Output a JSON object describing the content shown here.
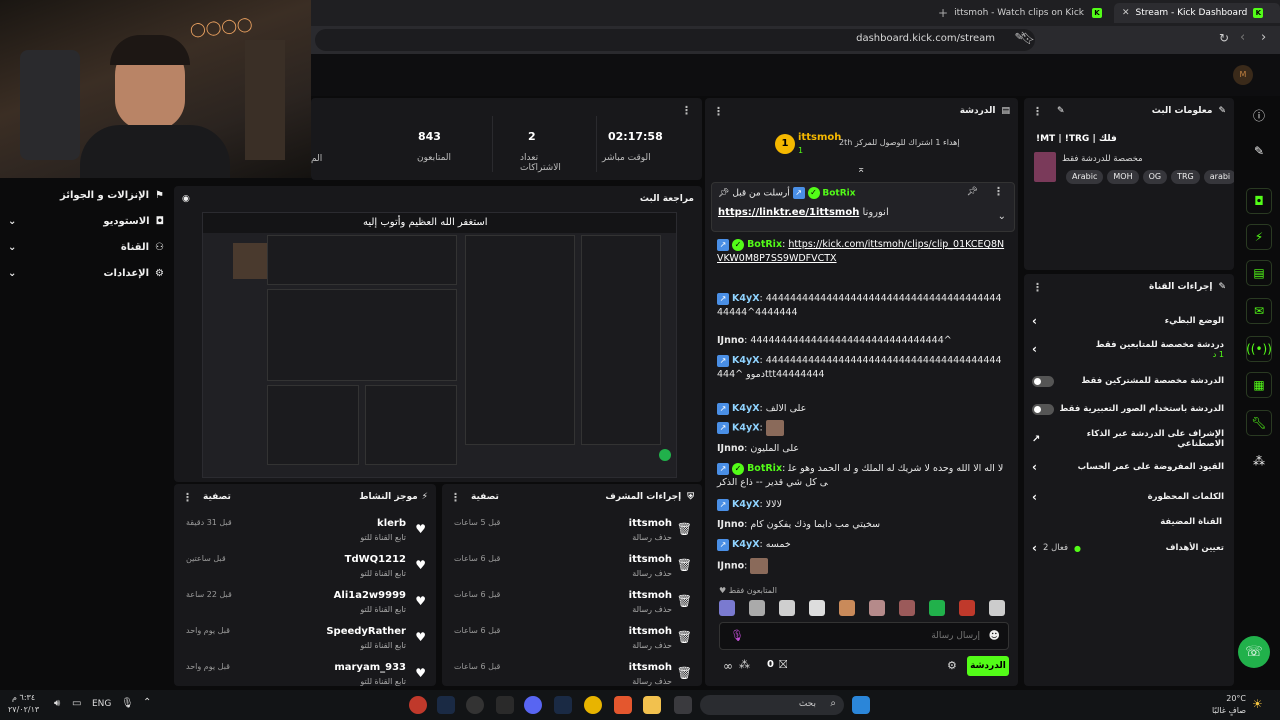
{
  "browser": {
    "tabs": [
      {
        "label": "ittsmoh - Watch clips on Kick"
      },
      {
        "label": "Stream - Kick Dashboard"
      }
    ],
    "url": "dashboard.kick.com/stream",
    "shield_count": "3"
  },
  "sidebar": {
    "items": [
      {
        "label": "الإنزالات و الجوائز"
      },
      {
        "label": "الاستوديو"
      },
      {
        "label": "القناة"
      },
      {
        "label": "الإعدادات"
      }
    ]
  },
  "stats": {
    "viewers": {
      "value": "843",
      "label": "المتابعون"
    },
    "subs": {
      "value": "2",
      "label": "تعداد الاشتراكات"
    },
    "live": {
      "value": "02:17:58",
      "label": "الوقت مباشر"
    },
    "partial_label": "الم"
  },
  "preview": {
    "title": "مراجعة البث",
    "caption": "استغفر الله العظيم وأتوب إليه"
  },
  "activity": {
    "title": "موجز النشاط",
    "filter": "تصفية",
    "rows": [
      {
        "name": "klerb",
        "sub": "تابع القناة للتو",
        "time": "قبل 31 دقيقة"
      },
      {
        "name": "TdWQ1212",
        "sub": "تابع القناة للتو",
        "time": "قبل ساعتين"
      },
      {
        "name": "Ali1a2w9999",
        "sub": "تابع القناة للتو",
        "time": "قبل 22 ساعة"
      },
      {
        "name": "SpeedyRather",
        "sub": "تابع القناة للتو",
        "time": "قبل يوم واحد"
      },
      {
        "name": "maryam_933",
        "sub": "تابع القناة للتو",
        "time": "قبل يوم واحد"
      }
    ]
  },
  "modactions": {
    "title": "إجراءات المشرف",
    "filter": "تصفية",
    "rows": [
      {
        "name": "ittsmoh",
        "sub": "حذف رسالة",
        "time": "قبل 5 ساعات"
      },
      {
        "name": "ittsmoh",
        "sub": "حذف رسالة",
        "time": "قبل 6 ساعات"
      },
      {
        "name": "ittsmoh",
        "sub": "حذف رسالة",
        "time": "قبل 6 ساعات"
      },
      {
        "name": "ittsmoh",
        "sub": "حذف رسالة",
        "time": "قبل 6 ساعات"
      },
      {
        "name": "ittsmoh",
        "sub": "حذف رسالة",
        "time": "قبل 6 ساعات"
      }
    ]
  },
  "chat": {
    "title": "الدردشة",
    "top_user": "ittsmoh",
    "top_user_count": "1",
    "top_rank": "1",
    "sub_goal": "إهداء 1 اشتراك للوصول للمركز 2",
    "sub_goal_rank": "th",
    "pinned_by_label": "أرسلت من قبل",
    "pinned_by": "BotRix",
    "pinned_text": "https://linktr.ee/1ittsmoh",
    "pinned_tail": "انورونا",
    "messages": [
      {
        "user": "BotRix",
        "text": "https://kick.com/ittsmoh/clips/clip_01KCEQ8NVKW0M8P7SS9WDFVCTX"
      },
      {
        "user": "K4yX",
        "text": "44444444444444444444444444444444444444444444^4444444"
      },
      {
        "user": "IJnno",
        "text": "44444444444444444444444444444444^"
      },
      {
        "user": "K4yX",
        "text": "444444444444444444444444444444444444444444^ دمووttt44444444"
      },
      {
        "user": "K4yX",
        "text": "على الالف"
      },
      {
        "user": "K4yX",
        "text": ""
      },
      {
        "user": "IJnno",
        "text": "على المليون"
      },
      {
        "user": "BotRix",
        "text": "لا اله الا الله وحده لا شريك له الملك و له الحمد وهو على كل شي قدير -- ذاع الذكر"
      },
      {
        "user": "K4yX",
        "text": "لالالا"
      },
      {
        "user": "IJnno",
        "text": "سخيتي مب دايما وذك يفكون كام"
      },
      {
        "user": "K4yX",
        "text": "خمسه"
      },
      {
        "user": "IJnno",
        "text": ""
      }
    ],
    "followers_only": "المتابعون فقط",
    "input_placeholder": "إرسال رسالة",
    "send_label": "الدردشة",
    "points": "0"
  },
  "streaminfo": {
    "title": "معلومات البث",
    "stream_title": "!MT | !TRG | فلك",
    "category": "مخصصة للدردشة فقط",
    "tags": [
      "Arabic",
      "MOH",
      "OG",
      "TRG",
      "arabi"
    ]
  },
  "channel_actions": {
    "title": "إجراءات القناة",
    "rows": [
      {
        "label": "الوضع البطيء",
        "type": "chev"
      },
      {
        "label": "دردشة مخصصة للمتابعين فقط",
        "sub": "1 د",
        "type": "chev"
      },
      {
        "label": "الدردشة مخصصة للمشتركين فقط",
        "type": "toggle"
      },
      {
        "label": "الدردشة باستخدام الصور التعبيرية فقط",
        "type": "toggle"
      },
      {
        "label": "الإشراف على الدردشة عبر الذكاء الاصطناعي",
        "type": "ext"
      },
      {
        "label": "القيود المفروضة على عمر الحساب",
        "type": "chev"
      },
      {
        "label": "الكلمات المحظورة",
        "type": "chev"
      }
    ],
    "section": "القناة المضيفة",
    "goals_label": "تعيين الأهداف",
    "goals_value": "فعال 2"
  },
  "taskbar": {
    "search": "بحث",
    "lang": "ENG",
    "time": "٦:٣٤ م",
    "date": "٢٧/٠٢/١٣",
    "weather_temp": "20°C",
    "weather_desc": "صافٍ غالبًا"
  },
  "colors": {
    "accent": "#53fc18",
    "panel": "#18181b",
    "bg": "#0b0b0c"
  }
}
